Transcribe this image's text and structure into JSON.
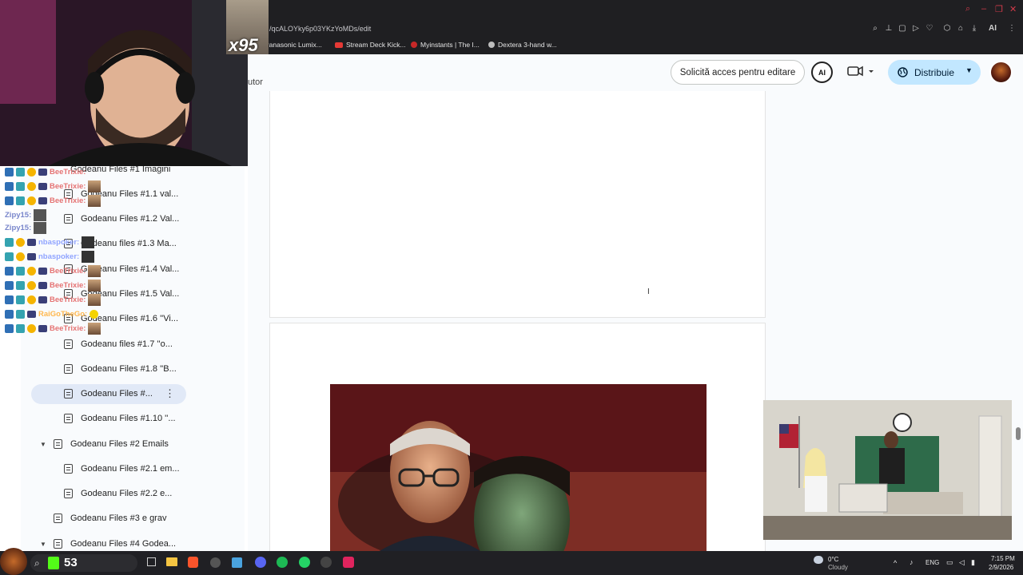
{
  "browser": {
    "url": "/qcALOYky6p03YKzYoMDs/edit",
    "bookmarks": [
      {
        "label": "Panasonic Lumix...",
        "color": "#d9d9d9"
      },
      {
        "label": "Stream Deck Kick...",
        "color": "#e53935"
      },
      {
        "label": "Myinstants | The I...",
        "color": "#c62828"
      },
      {
        "label": "Dextera 3-hand w...",
        "color": "#bdbdbd"
      }
    ],
    "toolbar_ai_label": "AI"
  },
  "docs_header": {
    "author_fragment": "utor",
    "request_access_label": "Solicită acces pentru editare",
    "share_label": "Distribuie",
    "ai_badge_label": "AI"
  },
  "stream_overlay": {
    "multiplier": "x95",
    "chat": [
      {
        "user": "BeeTrixie:",
        "color": "#e57373"
      },
      {
        "user": "BeeTrixie:",
        "color": "#e57373"
      },
      {
        "user": "BeeTrixie:",
        "color": "#e57373"
      },
      {
        "user": "Zipy15:",
        "color": "#7986cb"
      },
      {
        "user": "Zipy15:",
        "color": "#7986cb"
      },
      {
        "user": "nbaspoker:",
        "color": "#90a4ff"
      },
      {
        "user": "nbaspoker:",
        "color": "#90a4ff"
      },
      {
        "user": "BeeTrixie:",
        "color": "#e57373"
      },
      {
        "user": "BeeTrixie:",
        "color": "#e57373"
      },
      {
        "user": "BeeTrixie:",
        "color": "#e57373"
      },
      {
        "user": "RaiGoTheGo:",
        "color": "#ffb74d"
      },
      {
        "user": "BeeTrixie:",
        "color": "#e57373"
      }
    ]
  },
  "outline": {
    "items": [
      {
        "label": "Godeanu Files #1 Imagini",
        "level": 1
      },
      {
        "label": "Godeanu Files #1.1 val...",
        "level": 2
      },
      {
        "label": "Godeanu Files #1.2 Val...",
        "level": 2
      },
      {
        "label": "Godeanu files #1.3 Ma...",
        "level": 2
      },
      {
        "label": "Godeanu Files #1.4 Val...",
        "level": 2
      },
      {
        "label": "Godeanu Files #1.5 Val...",
        "level": 2
      },
      {
        "label": "Godeanu Files #1.6 ''Vi...",
        "level": 2
      },
      {
        "label": "Godeanu files #1.7 ''o...",
        "level": 2
      },
      {
        "label": "Godeanu Files #1.8 ''B...",
        "level": 2
      },
      {
        "label": "Godeanu Files #...",
        "level": 2
      },
      {
        "label": "Godeanu Files #1.10 ''...",
        "level": 2
      },
      {
        "label": "Godeanu Files #2 Emails",
        "level": 1
      },
      {
        "label": "Godeanu Files #2.1 em...",
        "level": 2
      },
      {
        "label": "Godeanu Files #2.2 e...",
        "level": 2
      },
      {
        "label": "Godeanu Files #3 e grav",
        "level": 1
      },
      {
        "label": "Godeanu Files #4 Godea...",
        "level": 1
      }
    ]
  },
  "taskbar": {
    "badge_count": "53",
    "weather_temp": "0°C",
    "weather_desc": "Cloudy",
    "language": "ENG",
    "time": "7:15 PM",
    "date": "2/9/2026"
  }
}
